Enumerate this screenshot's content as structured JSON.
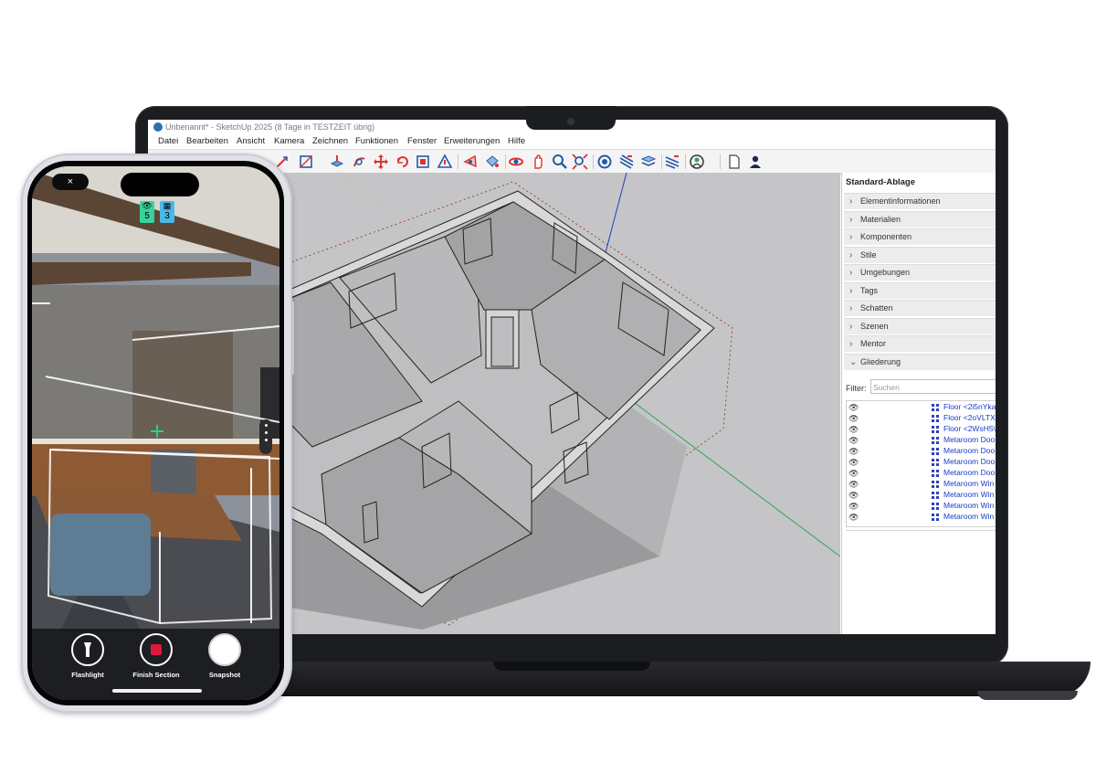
{
  "sketchup": {
    "window_title": "Unbenannt* - SketchUp 2025 (8 Tage in TESTZEIT übrig)",
    "menu": [
      "Datei",
      "Bearbeiten",
      "Ansicht",
      "Kamera",
      "Zeichnen",
      "Funktionen",
      "Fenster",
      "Erweiterungen",
      "Hilfe"
    ],
    "toolbar_icons": [
      "draw-tool-icon",
      "rectangle-tool-icon",
      "push-pull-icon",
      "move-icon",
      "rotate-arrows-icon",
      "follow-me-icon",
      "scale-icon",
      "offset-icon",
      "tape-measure-icon",
      "paint-bucket-icon",
      "orbit-icon",
      "pan-icon",
      "zoom-icon",
      "zoom-extents-icon",
      "component-icon",
      "section-plane-icon",
      "section-display-icon",
      "layers-icon",
      "geo-location-icon",
      "new-document-icon",
      "account-icon"
    ],
    "tray": {
      "title": "Standard-Ablage",
      "panels": [
        "Elementinformationen",
        "Materialien",
        "Komponenten",
        "Stile",
        "Umgebungen",
        "Tags",
        "Schatten",
        "Szenen",
        "Mentor"
      ],
      "expanded_panel": "Gliederung",
      "filter_label": "Filter:",
      "filter_placeholder": "Suchen",
      "outliner_rows": [
        "Floor <2i5nYka",
        "Floor <2oVLTX",
        "Floor <2WsH5\\",
        "Metaroom Doo",
        "Metaroom Doo",
        "Metaroom Doo",
        "Metaroom Doo",
        "Metaroom Win",
        "Metaroom Win",
        "Metaroom Win",
        "Metaroom Win"
      ]
    },
    "colors": {
      "outliner_icon": "#2b3fbf",
      "axis_red": "#d9312b",
      "axis_green": "#2fa84f",
      "axis_blue": "#1f3fbf"
    }
  },
  "phone": {
    "close_icon": "×",
    "badges": [
      {
        "icon": "eye-icon",
        "glyph": "👁",
        "value": "5",
        "color": "#37d39a"
      },
      {
        "icon": "qr-icon",
        "glyph": "▦",
        "value": "3",
        "color": "#49b8e6"
      }
    ],
    "controls": [
      {
        "icon": "flashlight-icon",
        "label": "Flashlight"
      },
      {
        "icon": "stop-record-icon",
        "label": "Finish Section"
      },
      {
        "icon": "shutter-icon",
        "label": "Snapshot"
      }
    ]
  }
}
